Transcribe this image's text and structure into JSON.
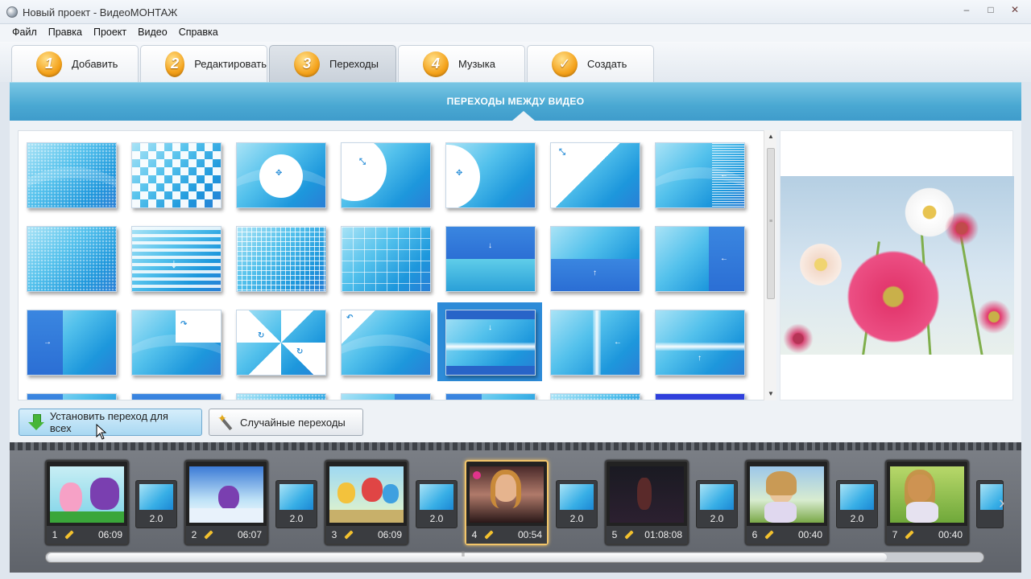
{
  "window": {
    "title": "Новый проект - ВидеоМОНТАЖ",
    "minimize": "–",
    "maximize": "□",
    "close": "✕"
  },
  "menu": [
    "Файл",
    "Правка",
    "Проект",
    "Видео",
    "Справка"
  ],
  "tabs": [
    {
      "num": "1",
      "label": "Добавить"
    },
    {
      "num": "2",
      "label": "Редактировать"
    },
    {
      "num": "3",
      "label": "Переходы"
    },
    {
      "num": "4",
      "label": "Музыка"
    },
    {
      "num": "✓",
      "label": "Создать"
    }
  ],
  "active_tab": "Переходы",
  "section": {
    "title": "ПЕРЕХОДЫ МЕЖДУ ВИДЕО"
  },
  "buttons": {
    "apply_all": "Установить переход для всех",
    "random": "Случайные переходы"
  },
  "timeline": {
    "clips": [
      {
        "index": "1",
        "duration": "06:09"
      },
      {
        "index": "2",
        "duration": "06:07"
      },
      {
        "index": "3",
        "duration": "06:09"
      },
      {
        "index": "4",
        "duration": "00:54"
      },
      {
        "index": "5",
        "duration": "01:08:08"
      },
      {
        "index": "6",
        "duration": "00:40"
      },
      {
        "index": "7",
        "duration": "00:40"
      }
    ],
    "transitions": [
      "2.0",
      "2.0",
      "2.0",
      "2.0",
      "2.0",
      "2.0"
    ],
    "active_clip": "4"
  },
  "colors": {
    "accent": "#4aa8d2",
    "tab_badge": "#f4a21b",
    "selected_frame": "#2d8bd8",
    "timeline_bg": "#6b6f76"
  }
}
